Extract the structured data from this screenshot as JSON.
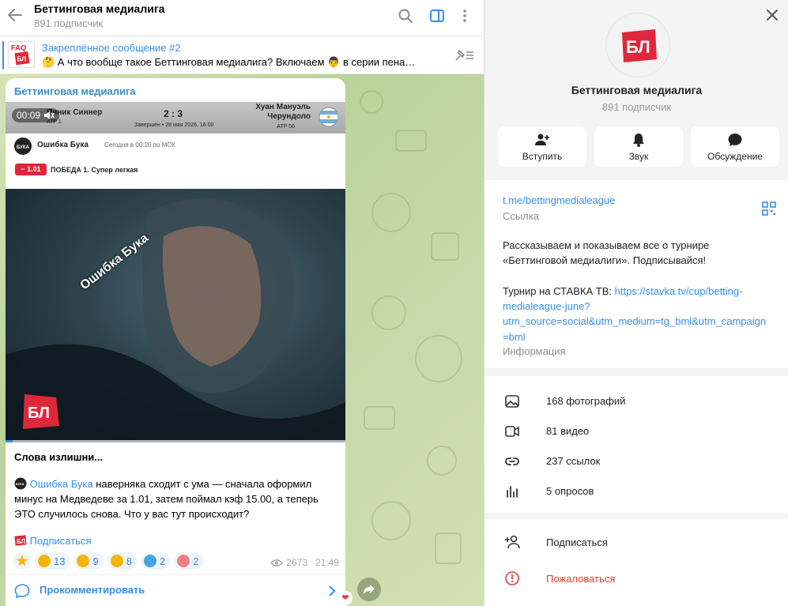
{
  "header": {
    "title": "Беттинговая медиалига",
    "subtitle": "891 подписчик"
  },
  "pinned": {
    "title": "Закреплённое сообщение #2",
    "text": "🤔 А что вообще такое Беттинговая медиалига?   Включаем 👨 в серии пена…"
  },
  "message": {
    "author": "Беттинговая медиалига",
    "video_time": "00:09",
    "video_progress": 0.02,
    "scoreboard": {
      "left_player": "Янник Синнер",
      "left_rank": "ATP 1",
      "score": "2 : 3",
      "status": "Завершен • 28 мая 2026, 16:00",
      "right_player_line1": "Хуан Мануэль",
      "right_player_line2": "Черундоло",
      "right_rank": "ATP 56"
    },
    "bet": {
      "name": "Ошибка Бука",
      "time": "Сегодня в 00:20 по МСК",
      "odds": "− 1.01",
      "outcome": "ПОБЕДА 1. Супер легкая"
    },
    "overlay_caption": "Ошибка Бука",
    "headline": "Слова излишни...",
    "body_link": "Ошибка Бука",
    "body_line1": " наверняка сходит с ума — сначала оформил",
    "body_line2": "минус на Медведеве за 1.01, затем поймал кэф 15.00, а теперь",
    "body_line3": "ЭТО случилось снова. Что у вас тут происходит?",
    "subscribe_link": "Подписаться",
    "reactions": [
      {
        "emoji": "star",
        "count": "",
        "color": "#f5b400"
      },
      {
        "emoji": "dizzy-face",
        "count": "13",
        "color": "#f5b400"
      },
      {
        "emoji": "rofl",
        "count": "9",
        "color": "#f5b400"
      },
      {
        "emoji": "grin",
        "count": "8",
        "color": "#f5b400"
      },
      {
        "emoji": "scream",
        "count": "2",
        "color": "#4aa3df"
      },
      {
        "emoji": "clown",
        "count": "2",
        "color": "#f08080"
      }
    ],
    "views": "2673",
    "time": "21:49",
    "comment_label": "Прокомментировать"
  },
  "panel": {
    "title": "Беттинговая медиалига",
    "subtitle": "891 подписчик",
    "actions": [
      {
        "label": "Вступить",
        "icon": "add-user-icon"
      },
      {
        "label": "Звук",
        "icon": "bell-icon"
      },
      {
        "label": "Обсуждение",
        "icon": "chat-bubble-icon"
      }
    ],
    "link": "t.me/bettingmedialeague",
    "link_caption": "Ссылка",
    "desc_line1": "Рассказываем и показываем все о турнире",
    "desc_line2": "«Беттинговой медиалиги». Подписывайся!",
    "desc_prefix": "Турнир на СТАВКА ТВ: ",
    "desc_url_1": "https://stavka.tv/cup/betting-",
    "desc_url_2": "medialeague-june?",
    "desc_url_3": "utm_source=social&utm_medium=tg_bml&utm_campaign",
    "desc_url_4": "=bml",
    "desc_caption": "Информация",
    "media": [
      {
        "label": "168 фотографий",
        "icon": "photo-icon"
      },
      {
        "label": "81 видео",
        "icon": "video-icon"
      },
      {
        "label": "237 ссылок",
        "icon": "link-icon"
      },
      {
        "label": "5 опросов",
        "icon": "poll-icon"
      }
    ],
    "subscribe": "Подписаться",
    "report": "Пожаловаться"
  },
  "colors": {
    "accent": "#3390ec",
    "danger": "#e53935",
    "brand_red": "#e0263a"
  }
}
